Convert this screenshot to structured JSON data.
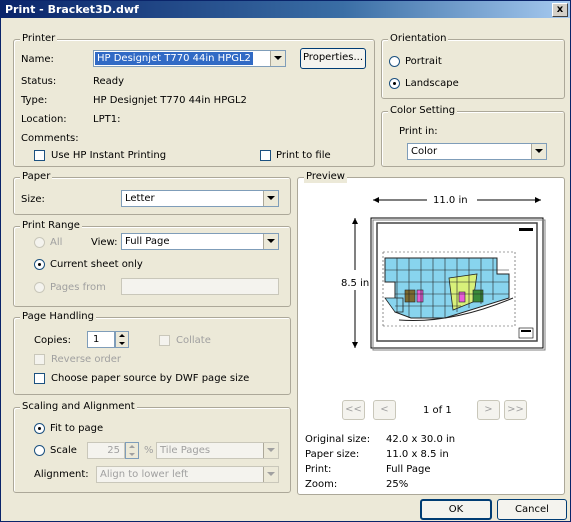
{
  "window": {
    "title": "Print - Bracket3D.dwf",
    "close": "x"
  },
  "printer": {
    "legend": "Printer",
    "name_label": "Name:",
    "name_value": "HP Designjet T770 44in HPGL2",
    "properties_label": "Properties...",
    "status_label": "Status:",
    "status_value": "Ready",
    "type_label": "Type:",
    "type_value": "HP Designjet T770 44in HPGL2",
    "location_label": "Location:",
    "location_value": "LPT1:",
    "comments_label": "Comments:",
    "instant_printing_label": "Use HP Instant Printing",
    "print_to_file_label": "Print to file"
  },
  "orientation": {
    "legend": "Orientation",
    "portrait_label": "Portrait",
    "landscape_label": "Landscape",
    "selected": "Landscape"
  },
  "color_setting": {
    "legend": "Color Setting",
    "print_in_label": "Print in:",
    "value": "Color"
  },
  "paper": {
    "legend": "Paper",
    "size_label": "Size:",
    "size_value": "Letter"
  },
  "print_range": {
    "legend": "Print Range",
    "all_label": "All",
    "view_label": "View:",
    "view_value": "Full Page",
    "current_sheet_label": "Current sheet only",
    "pages_from_label": "Pages from"
  },
  "page_handling": {
    "legend": "Page Handling",
    "copies_label": "Copies:",
    "copies_value": "1",
    "collate_label": "Collate",
    "reverse_order_label": "Reverse order",
    "choose_source_label": "Choose paper source by DWF page size"
  },
  "scaling": {
    "legend": "Scaling and Alignment",
    "fit_label": "Fit to page",
    "scale_label": "Scale",
    "scale_value": "25",
    "percent": "%",
    "tile_value": "Tile Pages",
    "alignment_label": "Alignment:",
    "alignment_value": "Align to lower left"
  },
  "preview": {
    "legend": "Preview",
    "width_label": "11.0 in",
    "height_label": "8.5 in",
    "first_label": "<<",
    "prev_label": "<",
    "page_indicator": "1 of 1",
    "next_label": ">",
    "last_label": ">>",
    "original_size_label": "Original size:",
    "original_size_value": "42.0 x 30.0 in",
    "paper_size_label": "Paper size:",
    "paper_size_value": "11.0 x 8.5 in",
    "print_label": "Print:",
    "print_value": "Full Page",
    "zoom_label": "Zoom:",
    "zoom_value": "25%"
  },
  "footer": {
    "ok_label": "OK",
    "cancel_label": "Cancel"
  }
}
